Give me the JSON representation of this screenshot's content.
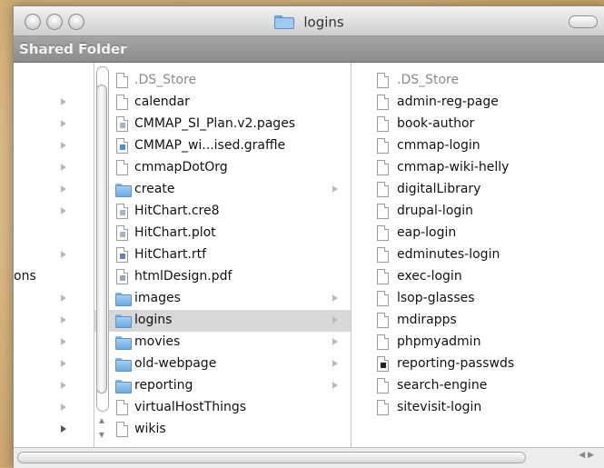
{
  "window": {
    "title": "logins"
  },
  "sidebar": {
    "header": "Shared Folder"
  },
  "col1": {
    "partial_label": "ons",
    "arrows": [
      null,
      "light",
      "light",
      "light",
      "light",
      "light",
      "light",
      null,
      "light",
      null,
      "light",
      "light",
      "light",
      "light",
      "light",
      "light",
      "dark"
    ]
  },
  "col2": {
    "items": [
      {
        "name": ".DS_Store",
        "icon": "document-icon",
        "dim": true,
        "arrow": false
      },
      {
        "name": "calendar",
        "icon": "document-icon",
        "arrow": false
      },
      {
        "name": "CMMAP_SI_Plan.v2.pages",
        "icon": "pages-document-icon",
        "arrow": false
      },
      {
        "name": "CMMAP_wi...ised.graffle",
        "icon": "graffle-document-icon",
        "arrow": false
      },
      {
        "name": "cmmapDotOrg",
        "icon": "document-icon",
        "arrow": false
      },
      {
        "name": "create",
        "icon": "folder-icon",
        "arrow": true
      },
      {
        "name": "HitChart.cre8",
        "icon": "cre8-document-icon",
        "arrow": false
      },
      {
        "name": "HitChart.plot",
        "icon": "plot-document-icon",
        "arrow": false
      },
      {
        "name": "HitChart.rtf",
        "icon": "rtf-document-icon",
        "arrow": false
      },
      {
        "name": "htmlDesign.pdf",
        "icon": "pdf-document-icon",
        "arrow": false
      },
      {
        "name": "images",
        "icon": "folder-icon",
        "arrow": true
      },
      {
        "name": "logins",
        "icon": "folder-icon",
        "arrow": true,
        "selected": true
      },
      {
        "name": "movies",
        "icon": "folder-icon",
        "arrow": true
      },
      {
        "name": "old-webpage",
        "icon": "folder-icon",
        "arrow": true
      },
      {
        "name": "reporting",
        "icon": "folder-icon",
        "arrow": true
      },
      {
        "name": "virtualHostThings",
        "icon": "document-icon",
        "arrow": false
      },
      {
        "name": "wikis",
        "icon": "document-icon",
        "arrow": false
      }
    ]
  },
  "col3": {
    "items": [
      {
        "name": ".DS_Store",
        "icon": "document-icon",
        "dim": true
      },
      {
        "name": "admin-reg-page",
        "icon": "document-icon"
      },
      {
        "name": "book-author",
        "icon": "document-icon"
      },
      {
        "name": "cmmap-login",
        "icon": "document-icon"
      },
      {
        "name": "cmmap-wiki-helly",
        "icon": "document-icon"
      },
      {
        "name": "digitalLibrary",
        "icon": "document-icon"
      },
      {
        "name": "drupal-login",
        "icon": "document-icon"
      },
      {
        "name": "eap-login",
        "icon": "document-icon"
      },
      {
        "name": "edminutes-login",
        "icon": "document-icon"
      },
      {
        "name": "exec-login",
        "icon": "document-icon"
      },
      {
        "name": "lsop-glasses",
        "icon": "document-icon"
      },
      {
        "name": "mdirapps",
        "icon": "document-icon"
      },
      {
        "name": "phpmyadmin",
        "icon": "document-icon"
      },
      {
        "name": "reporting-passwds",
        "icon": "alias-document-icon"
      },
      {
        "name": "search-engine",
        "icon": "document-icon"
      },
      {
        "name": "sitevisit-login",
        "icon": "document-icon"
      }
    ]
  },
  "colors": {
    "selection": "#d8d8d8",
    "folder": "#7eb6e6",
    "header_bar": "#999999"
  }
}
